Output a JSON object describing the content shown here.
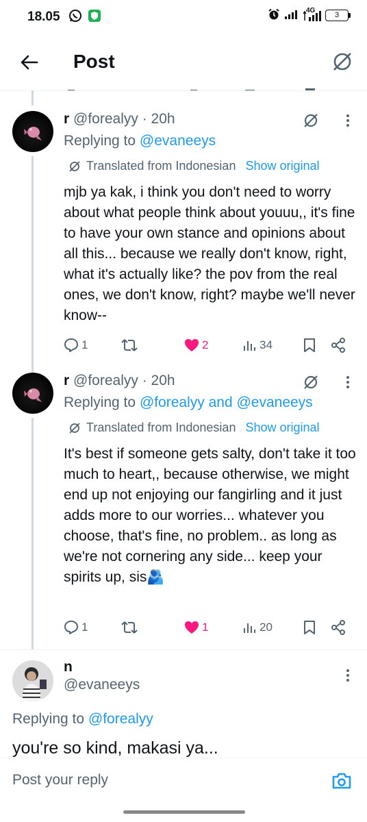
{
  "status_bar": {
    "time": "18.05",
    "network": "4G",
    "battery": "3",
    "icons": [
      "whatsapp-icon",
      "vpn-shield-icon",
      "alarm-icon",
      "wifi-signal-icon",
      "cell-signal-icon",
      "battery-icon"
    ]
  },
  "header": {
    "title": "Post"
  },
  "tweets": [
    {
      "name": "r",
      "handle": "@forealyy",
      "time": "· 20h",
      "replying_label": "Replying to ",
      "replying_to": "@evaneeys",
      "translated_label": "Translated from Indonesian",
      "show_original": "Show original",
      "text": "mjb ya kak, i think you don't need to worry about what people think about youuu,, it's fine to have your own stance and opinions about all this... because we really don't know, right, what it's actually like? the pov from the real ones, we don't know, right? maybe we'll never know--",
      "replies": "1",
      "retweets": "",
      "likes": "2",
      "views": "34"
    },
    {
      "name": "r",
      "handle": "@forealyy",
      "time": "· 20h",
      "replying_label": "Replying to ",
      "replying_to": "@forealyy and @evaneeys",
      "translated_label": "Translated from Indonesian",
      "show_original": "Show original",
      "text": "It's best if someone gets salty, don't take it too much to heart,, because otherwise, we might end up not enjoying our fangirling and it just adds more to our worries... whatever you choose, that's fine, no problem.. as long as we're not cornering any side... keep your spirits up, sis🫂",
      "replies": "1",
      "retweets": "",
      "likes": "1",
      "views": "20"
    },
    {
      "name": "n",
      "handle": "@evaneeys",
      "replying_label": "Replying to ",
      "replying_to": "@forealyy",
      "text": "you're so kind, makasi ya..."
    }
  ],
  "reply_bar": {
    "placeholder": "Post your reply"
  },
  "colors": {
    "accent": "#1d9bf0",
    "like": "#f91880",
    "muted": "#536471",
    "text": "#0f1419"
  }
}
